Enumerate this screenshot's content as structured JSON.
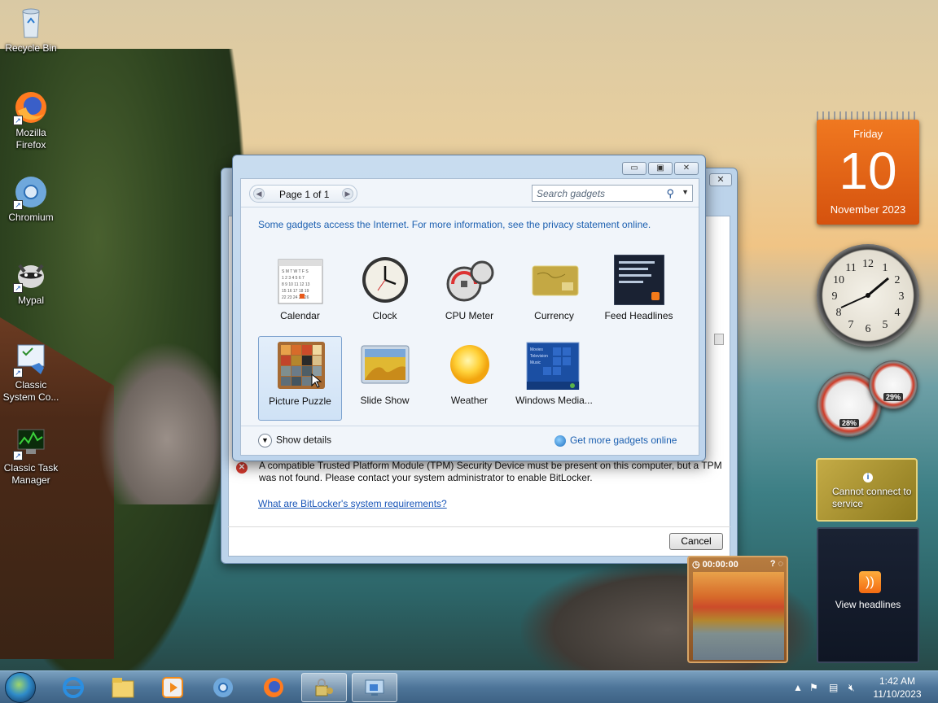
{
  "desktop": {
    "icons": [
      {
        "label": "Recycle Bin"
      },
      {
        "label": "Mozilla Firefox"
      },
      {
        "label": "Chromium"
      },
      {
        "label": "Mypal"
      },
      {
        "label": "Classic System Co..."
      },
      {
        "label": "Classic Task Manager"
      }
    ]
  },
  "bitlocker": {
    "error_text": "A compatible Trusted Platform Module (TPM) Security Device must be present on this computer, but a TPM was not found. Please contact your system administrator to enable BitLocker.",
    "requirements_link": "What are BitLocker's system requirements?",
    "cancel_label": "Cancel"
  },
  "gallery": {
    "pager_text": "Page 1 of 1",
    "search_placeholder": "Search gadgets",
    "privacy_text": "Some gadgets access the Internet.  For more information, see the privacy statement online.",
    "gadgets": [
      {
        "label": "Calendar",
        "icon": "calendar-icon"
      },
      {
        "label": "Clock",
        "icon": "clock-icon"
      },
      {
        "label": "CPU Meter",
        "icon": "cpu-meter-icon"
      },
      {
        "label": "Currency",
        "icon": "currency-icon"
      },
      {
        "label": "Feed Headlines",
        "icon": "feed-icon"
      },
      {
        "label": "Picture Puzzle",
        "icon": "puzzle-icon",
        "selected": true
      },
      {
        "label": "Slide Show",
        "icon": "slideshow-icon"
      },
      {
        "label": "Weather",
        "icon": "weather-icon"
      },
      {
        "label": "Windows Media...",
        "icon": "media-center-icon"
      }
    ],
    "show_details": "Show details",
    "get_more": "Get more gadgets online"
  },
  "side_gadgets": {
    "calendar": {
      "weekday": "Friday",
      "day": "10",
      "month_year": "November 2023"
    },
    "cpu_meter": {
      "cpu_pct": "28%",
      "mem_pct": "29%"
    },
    "currency": {
      "message": "Cannot connect to service"
    },
    "feed": {
      "label": "View headlines"
    },
    "puzzle": {
      "timer": "00:00:00"
    }
  },
  "taskbar": {
    "time": "1:42 AM",
    "date": "11/10/2023"
  },
  "colors": {
    "link": "#1b5fb0",
    "calendar_orange": "#e8681a",
    "error_red": "#d73a2f"
  }
}
